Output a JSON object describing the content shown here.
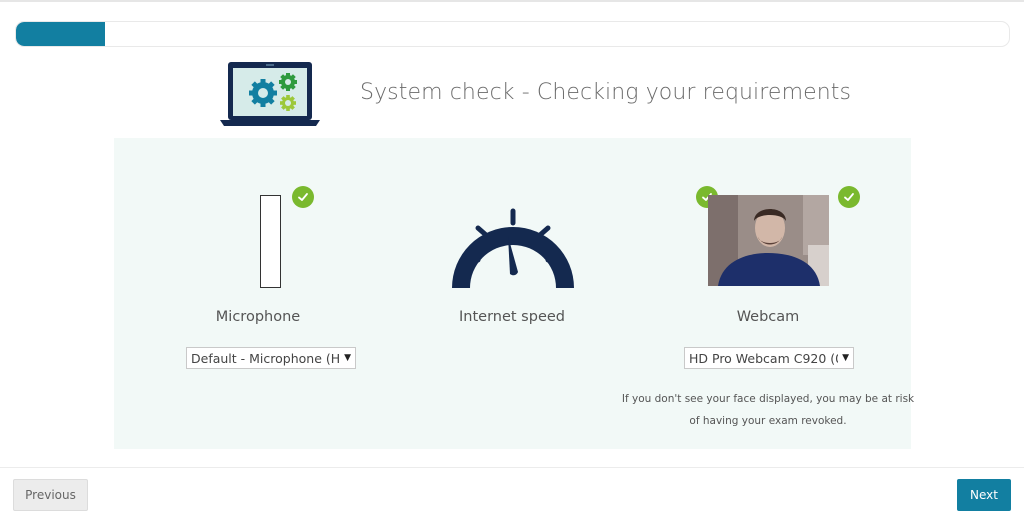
{
  "progress": {
    "percent": 9,
    "fill_color": "#127fa1"
  },
  "header": {
    "title": "System check - Checking your requirements",
    "icon": "laptop-gears-icon"
  },
  "checks": [
    {
      "id": "microphone",
      "label": "Microphone",
      "status": "passed",
      "status_icon": "check-circle-icon",
      "select_value": "Default - Microphone (H"
    },
    {
      "id": "internet-speed",
      "label": "Internet speed",
      "status": "passed",
      "status_icon": "check-circle-icon",
      "icon": "speedometer-icon"
    },
    {
      "id": "webcam",
      "label": "Webcam",
      "status": "passed",
      "status_icon": "check-circle-icon",
      "select_value": "HD Pro Webcam C920 (0",
      "note": "If you don't see your face displayed, you may be at risk of having your exam revoked."
    }
  ],
  "footer": {
    "previous_label": "Previous",
    "next_label": "Next"
  },
  "colors": {
    "accent": "#127fa1",
    "success": "#7ab92e",
    "gauge": "#14294f",
    "panel_bg": "#f2f9f7"
  }
}
